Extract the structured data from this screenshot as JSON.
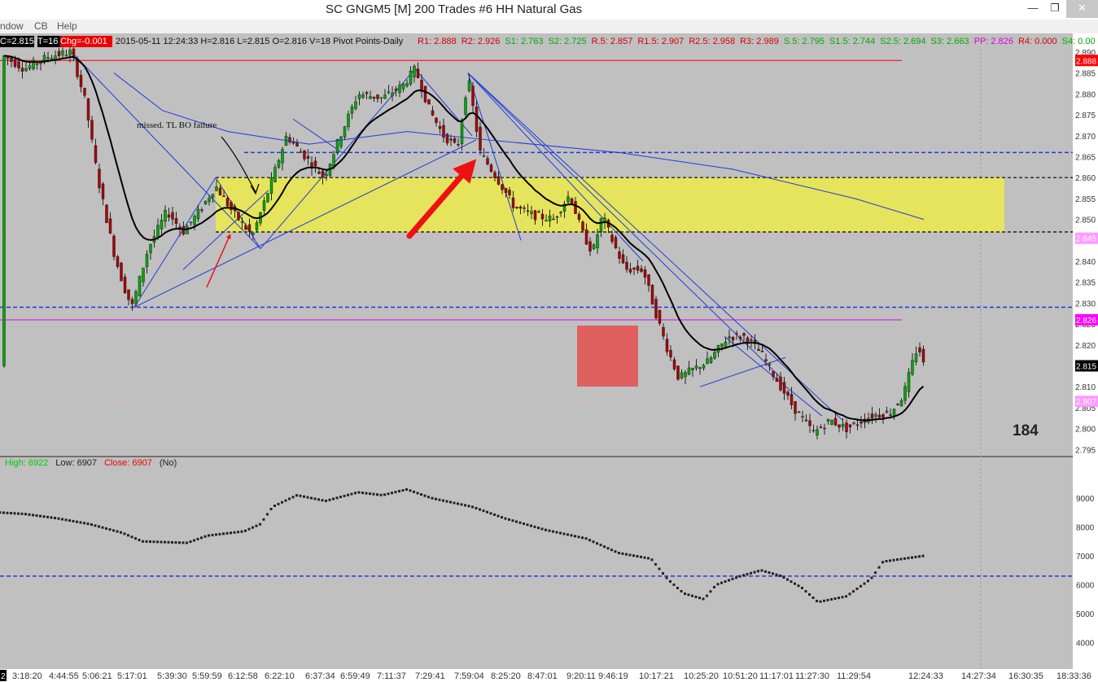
{
  "window": {
    "title": "SC GNGM5 [M]  200 Trades  #6  HH Natural Gas",
    "min_glyph": "—",
    "max_glyph": "❐",
    "close_glyph": "✕"
  },
  "menu": [
    {
      "label": "ndow"
    },
    {
      "label": "CB"
    },
    {
      "label": "Help"
    }
  ],
  "info_bar": {
    "c": "C=2.815",
    "t": "T=16",
    "chg": "Chg=-0.001",
    "stats": "2015-05-11 12:24:33 H=2.816 L=2.815 O=2.816 V=18 Pivot Points-Daily",
    "pivots": [
      {
        "text": "R1: 2.888",
        "color": "#d40000"
      },
      {
        "text": "R2: 2.926",
        "color": "#d40000"
      },
      {
        "text": "S1: 2.763",
        "color": "#00aa00"
      },
      {
        "text": "S2: 2.725",
        "color": "#00aa00"
      },
      {
        "text": "R.5: 2.857",
        "color": "#d40000"
      },
      {
        "text": "R1.5: 2.907",
        "color": "#d40000"
      },
      {
        "text": "R2.5: 2.958",
        "color": "#d40000"
      },
      {
        "text": "R3: 2.989",
        "color": "#d40000"
      },
      {
        "text": "S.5: 2.795",
        "color": "#00aa00"
      },
      {
        "text": "S1.5: 2.744",
        "color": "#00aa00"
      },
      {
        "text": "S2.5: 2.694",
        "color": "#00aa00"
      },
      {
        "text": "S3: 2.663",
        "color": "#00aa00"
      },
      {
        "text": "PP: 2.826",
        "color": "#e000e0"
      },
      {
        "text": "R4: 0.000",
        "color": "#d40000"
      },
      {
        "text": "S4: 0.00",
        "color": "#00aa00"
      }
    ]
  },
  "price_axis": {
    "labels": [
      "2.890",
      "2.885",
      "2.880",
      "2.875",
      "2.870",
      "2.865",
      "2.860",
      "2.855",
      "2.850",
      "2.845",
      "2.840",
      "2.835",
      "2.830",
      "2.825",
      "2.820",
      "2.815",
      "2.810",
      "2.805",
      "2.800",
      "2.795"
    ],
    "tags": [
      {
        "text": "2.888",
        "bg": "#ff0000",
        "fg": "#ffffff",
        "price": 2.888
      },
      {
        "text": "2.845",
        "bg": "#ff99ff",
        "fg": "#ffffff",
        "price": 2.8455
      },
      {
        "text": "2.826",
        "bg": "#ff00ff",
        "fg": "#ffffff",
        "price": 2.826
      },
      {
        "text": "2.815",
        "bg": "#000000",
        "fg": "#ffffff",
        "price": 2.815
      },
      {
        "text": "2.807",
        "bg": "#ff99ff",
        "fg": "#ffffff",
        "price": 2.8065
      }
    ]
  },
  "time_axis": {
    "labels": [
      "3:18:20",
      "4:44:55",
      "5:06:21",
      "5:17:01",
      "5:39:30",
      "5:59:59",
      "6:12:58",
      "6:22:10",
      "6:37:34",
      "6:59:49",
      "7:11:37",
      "7:29:41",
      "7:59:04",
      "8:25:20",
      "8:47:01",
      "9:20:11",
      "9:46:19",
      "10:17:21",
      "10:25:20",
      "10:51:20",
      "11:17:01",
      "11:27:30",
      "11:29:54",
      "12:24:33",
      "14:27:34",
      "16:30:35",
      "18:33:36"
    ],
    "edge_label": "2"
  },
  "annotations": {
    "text": "missed. TL BO failure",
    "bar_count": "184"
  },
  "lower_pane": {
    "high_label": "High: 6922",
    "low_label": "Low: 6907",
    "close_label": "Close: 6907",
    "no_label": "(No)",
    "axis_labels": [
      "9000",
      "8000",
      "7000",
      "6000",
      "5000",
      "4000"
    ]
  },
  "colors": {
    "background": "#c0c0c0",
    "zone": "#e5e45c",
    "marker_box": "#e06060",
    "arrow": "#ee1111",
    "trendline": "#1f3bd8",
    "pivot": "#e000e0",
    "resistance": "#ff0000",
    "up_candle": "#00aa00",
    "down_candle": "#aa0000"
  }
}
